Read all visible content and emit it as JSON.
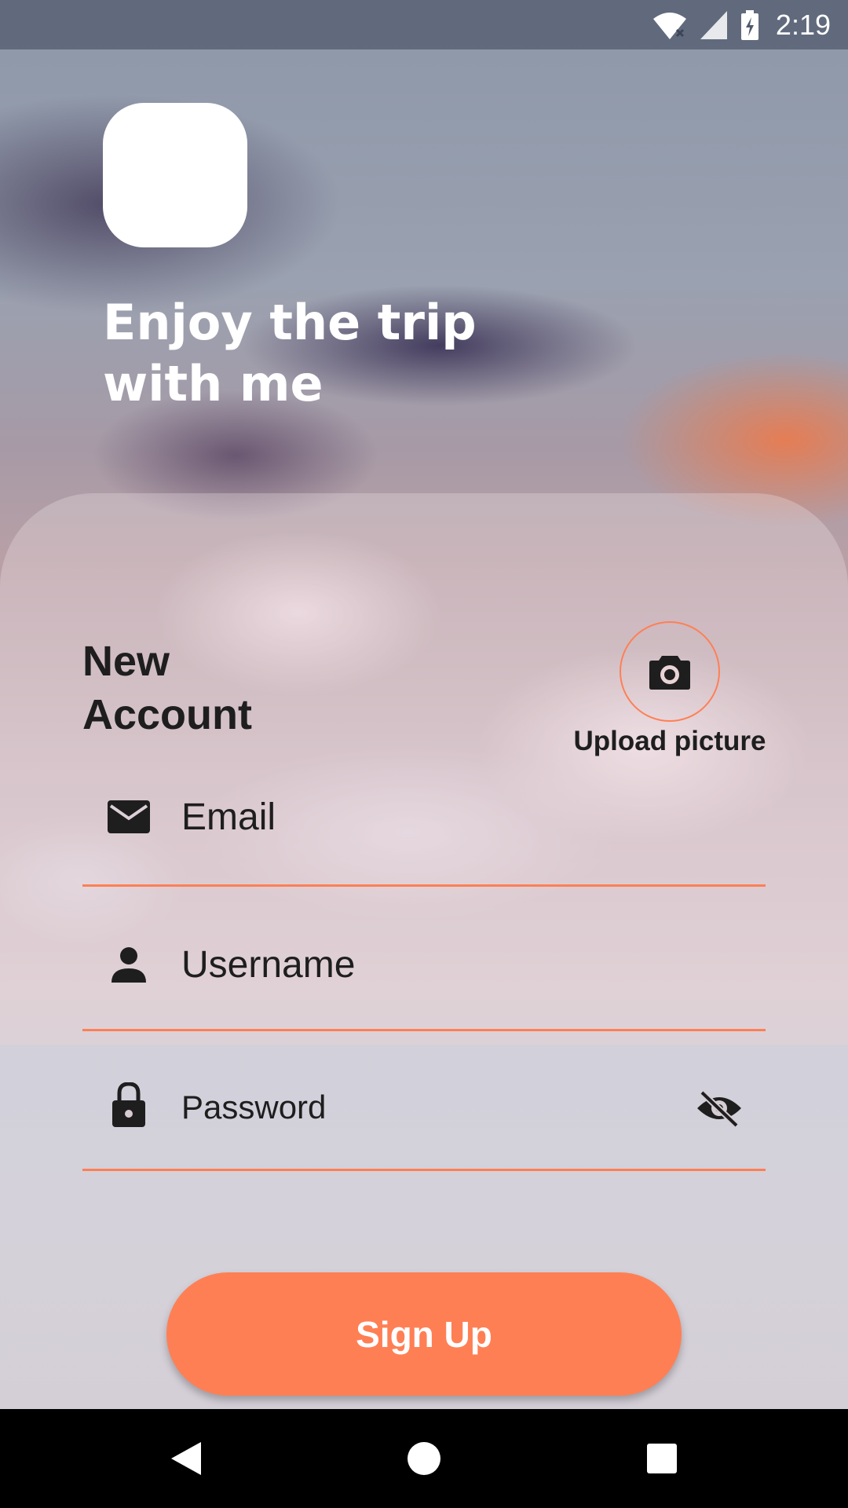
{
  "status_bar": {
    "time": "2:19",
    "icons": [
      "wifi-icon",
      "signal-icon",
      "battery-charging-icon"
    ]
  },
  "hero": {
    "headline_line1": "Enjoy the trip",
    "headline_line2": "with me"
  },
  "form": {
    "title_line1": "New",
    "title_line2": "Account",
    "upload_label": "Upload picture",
    "email_placeholder": "Email",
    "username_placeholder": "Username",
    "password_placeholder": "Password",
    "submit_label": "Sign Up"
  },
  "colors": {
    "accent": "#ff7f55",
    "text_dark": "#1e1e1e",
    "logo_bg": "#ffffff"
  }
}
